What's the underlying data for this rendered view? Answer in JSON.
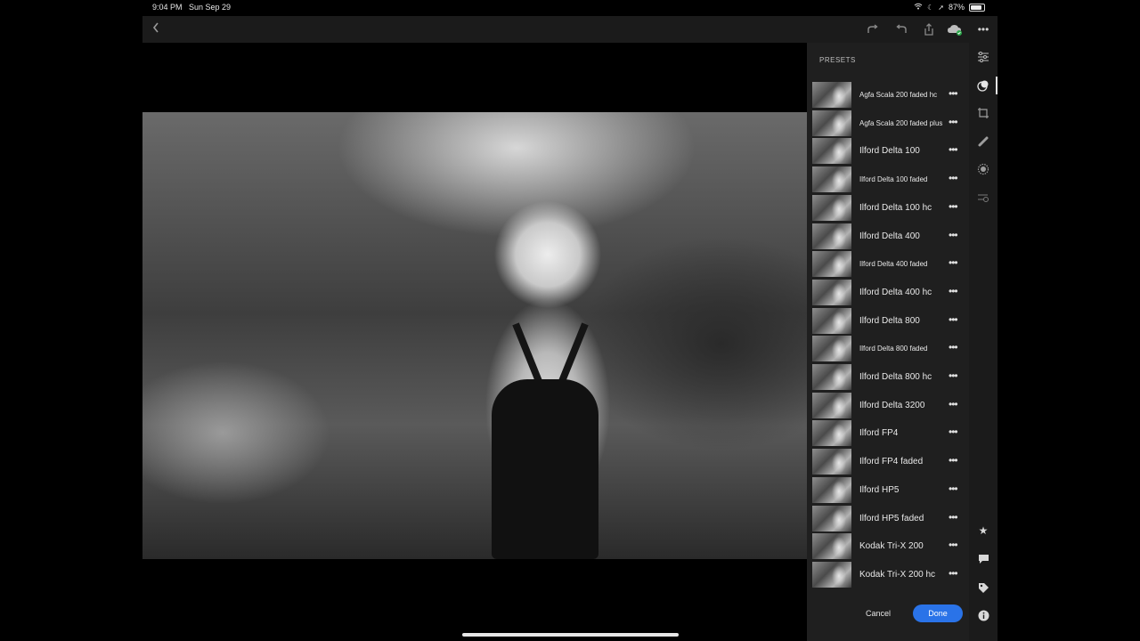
{
  "status_bar": {
    "time": "9:04 PM",
    "date": "Sun Sep 29",
    "battery_percent": "87%"
  },
  "toolbar": {
    "back_icon": "chevron-left",
    "redo_icon": "redo-arrow",
    "undo_icon": "undo-arrow",
    "share_icon": "share-box",
    "cloud_icon": "cloud-sync",
    "more_icon": "ellipsis"
  },
  "presets": {
    "title": "PRESETS",
    "items": [
      {
        "label": "Agfa Scala 200 faded hc",
        "small": true
      },
      {
        "label": "Agfa Scala 200 faded plus",
        "small": true
      },
      {
        "label": "Ilford Delta 100",
        "small": false
      },
      {
        "label": "Ilford Delta 100 faded",
        "small": true
      },
      {
        "label": "Ilford Delta 100 hc",
        "small": false
      },
      {
        "label": "Ilford Delta 400",
        "small": false
      },
      {
        "label": "Ilford Delta 400 faded",
        "small": true
      },
      {
        "label": "Ilford Delta 400 hc",
        "small": false
      },
      {
        "label": "Ilford Delta 800",
        "small": false
      },
      {
        "label": "Ilford Delta 800 faded",
        "small": true
      },
      {
        "label": "Ilford Delta 800 hc",
        "small": false
      },
      {
        "label": "Ilford Delta 3200",
        "small": false
      },
      {
        "label": "Ilford FP4",
        "small": false
      },
      {
        "label": "Ilford FP4 faded",
        "small": false
      },
      {
        "label": "Ilford HP5",
        "small": false
      },
      {
        "label": "Ilford HP5 faded",
        "small": false
      },
      {
        "label": "Kodak Tri-X 200",
        "small": false
      },
      {
        "label": "Kodak Tri-X 200 hc",
        "small": false
      }
    ],
    "more_glyph": "•••",
    "cancel_label": "Cancel",
    "done_label": "Done"
  },
  "rail": {
    "edit_icon": "sliders",
    "presets_icon": "presets-circles",
    "crop_icon": "crop-rotate",
    "heal_icon": "healing-brush",
    "mask_icon": "selective-mask",
    "versions_icon": "versions",
    "rate_icon": "star",
    "comment_icon": "comment",
    "tag_icon": "tag",
    "info_icon": "info"
  },
  "colors": {
    "accent": "#2a73e8",
    "panel_bg": "#1f1f1f",
    "rail_bg": "#1b1b1b"
  }
}
